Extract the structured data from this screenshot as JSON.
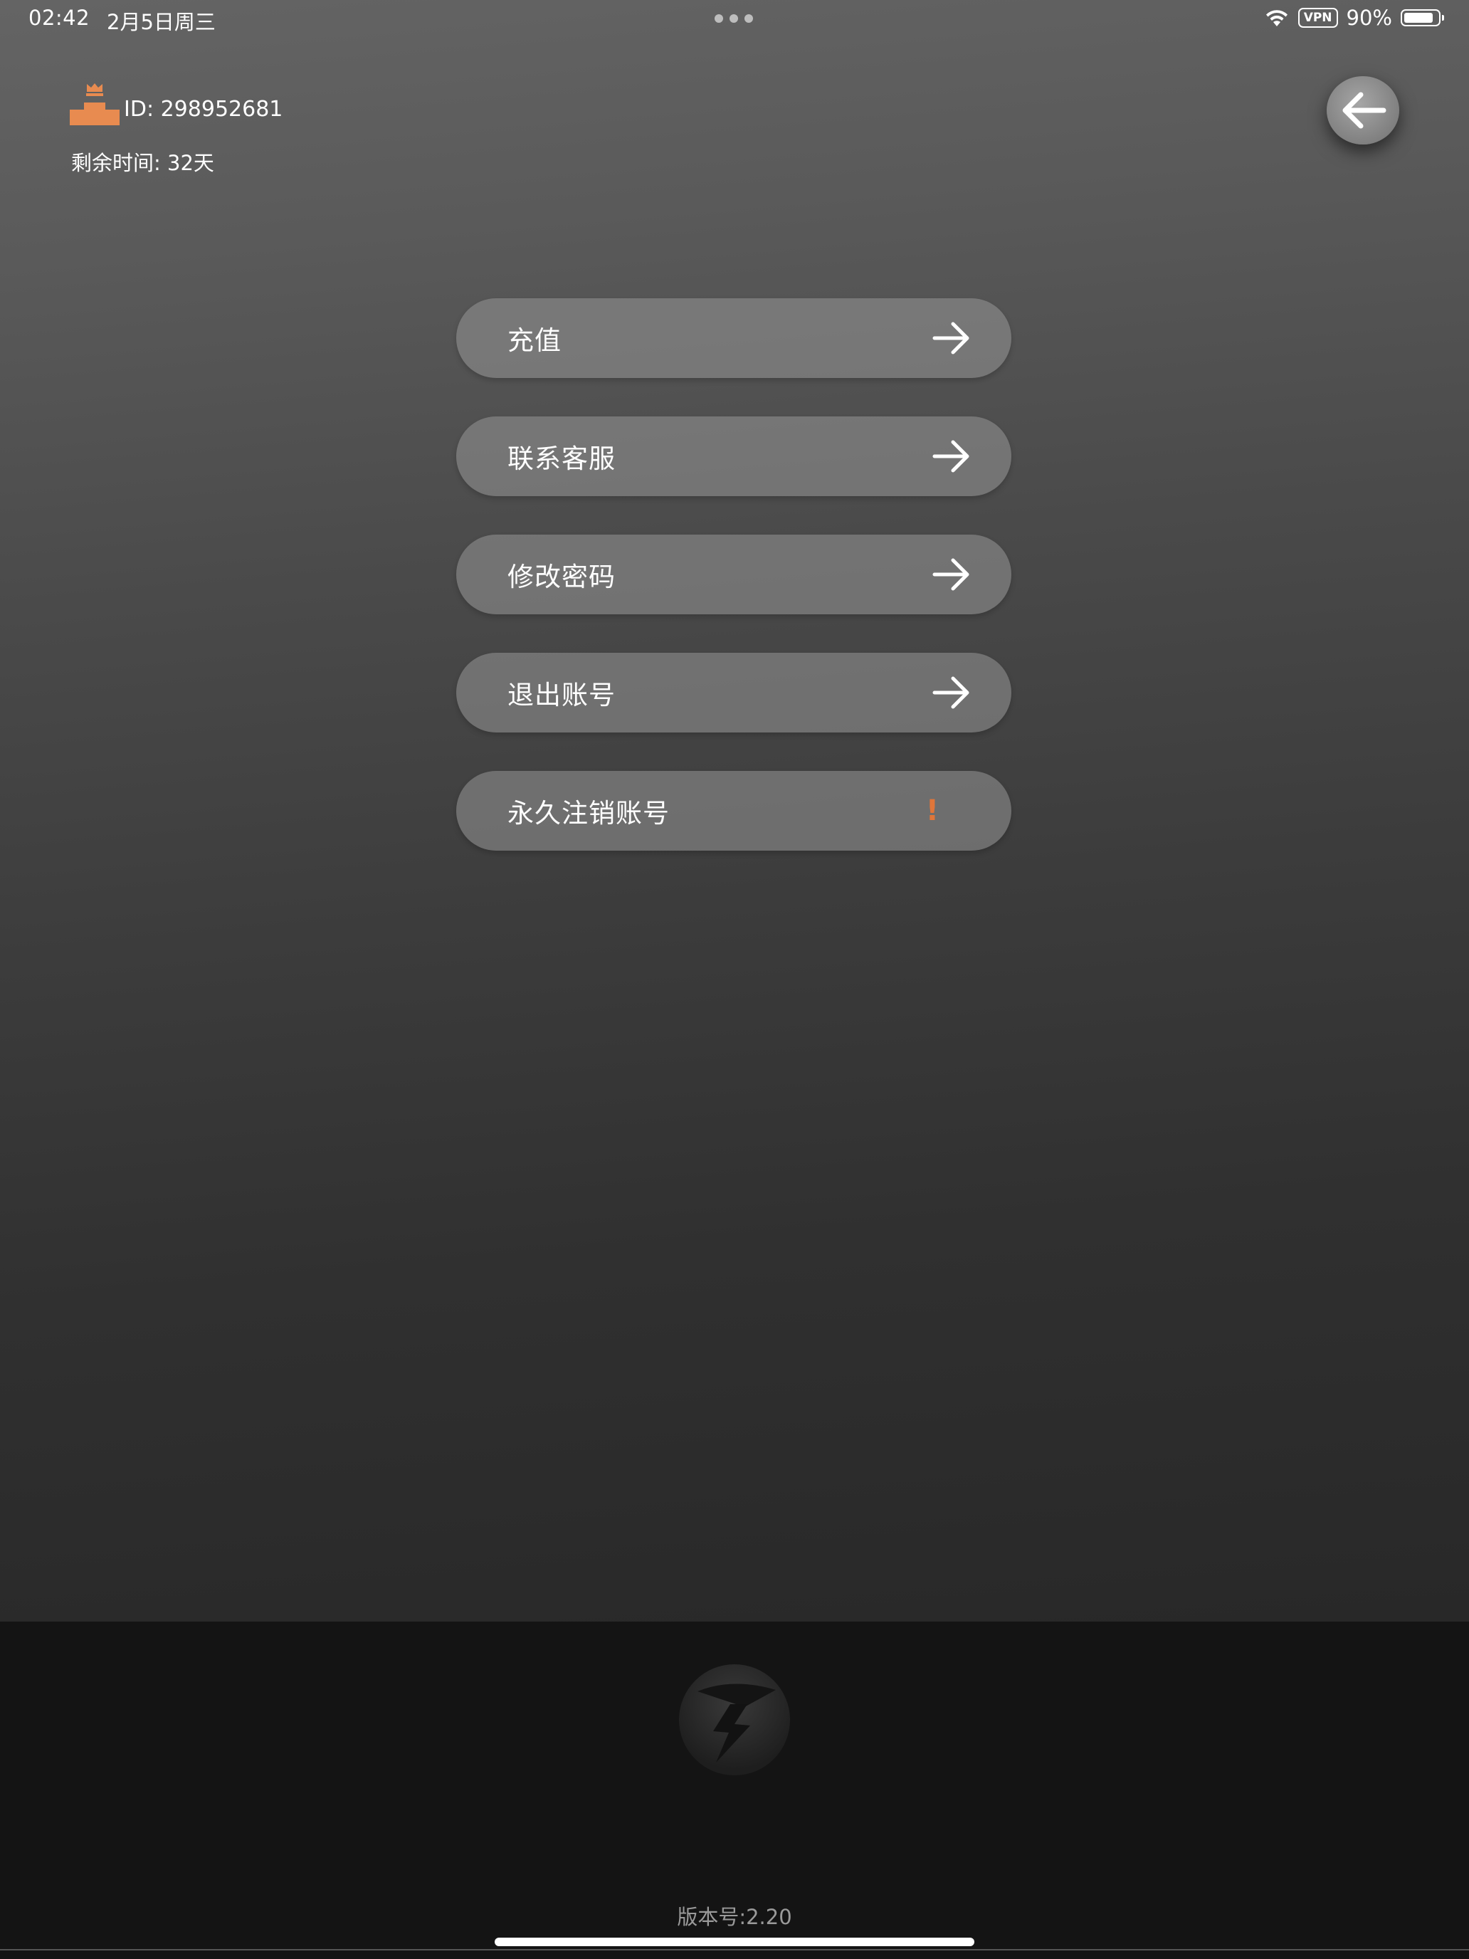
{
  "status_bar": {
    "time": "02:42",
    "date": "2月5日周三",
    "vpn": "VPN",
    "battery": "90%"
  },
  "user": {
    "id_text": "ID: 298952681",
    "remaining_text": "剩余时间: 32天",
    "vip_icon": "crown-podium-icon"
  },
  "colors": {
    "accent_orange": "#E88B50",
    "warning": "#E0763A"
  },
  "menu": {
    "items": [
      {
        "label": "充值",
        "icon": "arrow-right-icon"
      },
      {
        "label": "联系客服",
        "icon": "arrow-right-icon"
      },
      {
        "label": "修改密码",
        "icon": "arrow-right-icon"
      },
      {
        "label": "退出账号",
        "icon": "arrow-right-icon"
      },
      {
        "label": "永久注销账号",
        "warning": "!"
      }
    ]
  },
  "footer": {
    "version": "版本号:2.20"
  }
}
